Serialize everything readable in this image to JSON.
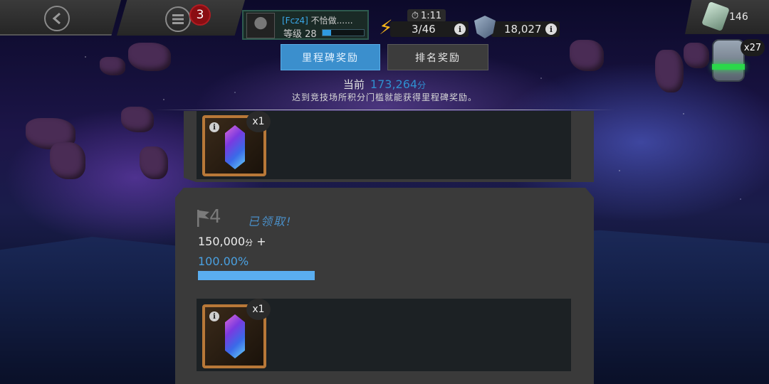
{
  "top_bar": {
    "notification_count": "3",
    "player": {
      "name_tag": "[Fcz4]",
      "name_suffix": "不恰做......",
      "level_label": "等级 28",
      "level_progress_fraction": 0.2
    },
    "energy": {
      "timer": "1:11",
      "value": "3/46"
    },
    "gold": {
      "value": "18,027"
    },
    "units": {
      "value": "146"
    },
    "crystal_stack": {
      "count": "x27"
    }
  },
  "tabs": [
    {
      "label": "里程碑奖励",
      "active": true
    },
    {
      "label": "排名奖励",
      "active": false
    }
  ],
  "summary": {
    "current_label": "当前",
    "current_value": "173,264",
    "current_unit": "分",
    "hint": "达到竞技场所积分门槛就能获得里程碑奖励。"
  },
  "rewards": [
    {
      "item_quantity": "x1",
      "item_icon": "crystal-icon"
    }
  ],
  "milestone": {
    "number": "4",
    "status": "已领取!",
    "threshold_value": "150,000",
    "threshold_unit": "分",
    "threshold_suffix": "+",
    "progress_text": "100.00%",
    "progress_fraction": 1.0,
    "reward": {
      "item_quantity": "x1",
      "item_icon": "crystal-icon"
    }
  },
  "colors": {
    "accent_blue": "#3b8fcd",
    "claimed_blue": "#4a8fc8",
    "progress_blue": "#5aaef0",
    "badge_red": "#8a0d12",
    "energy_yellow": "#f2b21a",
    "frame_bronze": "#b87838"
  }
}
